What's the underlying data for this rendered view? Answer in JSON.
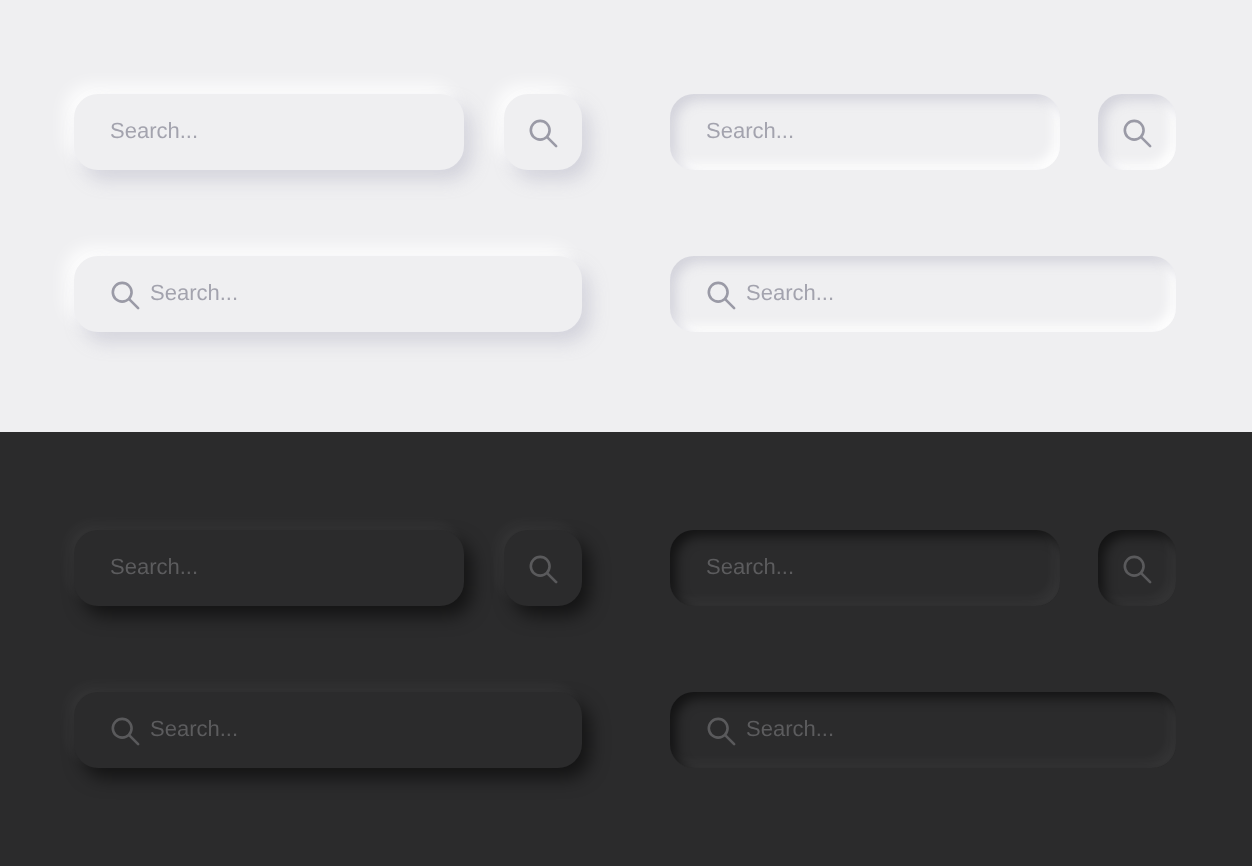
{
  "panels": [
    {
      "items": [
        {
          "kind": "pill",
          "placeholder": "Search..."
        },
        {
          "kind": "well",
          "placeholder": "Search..."
        },
        {
          "kind": "bar",
          "placeholder": "Search..."
        },
        {
          "kind": "trough",
          "placeholder": "Search..."
        }
      ]
    },
    {
      "items": [
        {
          "kind": "pill",
          "placeholder": "Search..."
        },
        {
          "kind": "well",
          "placeholder": "Search..."
        },
        {
          "kind": "bar",
          "placeholder": "Search..."
        },
        {
          "kind": "trough",
          "placeholder": "Search..."
        }
      ]
    }
  ]
}
